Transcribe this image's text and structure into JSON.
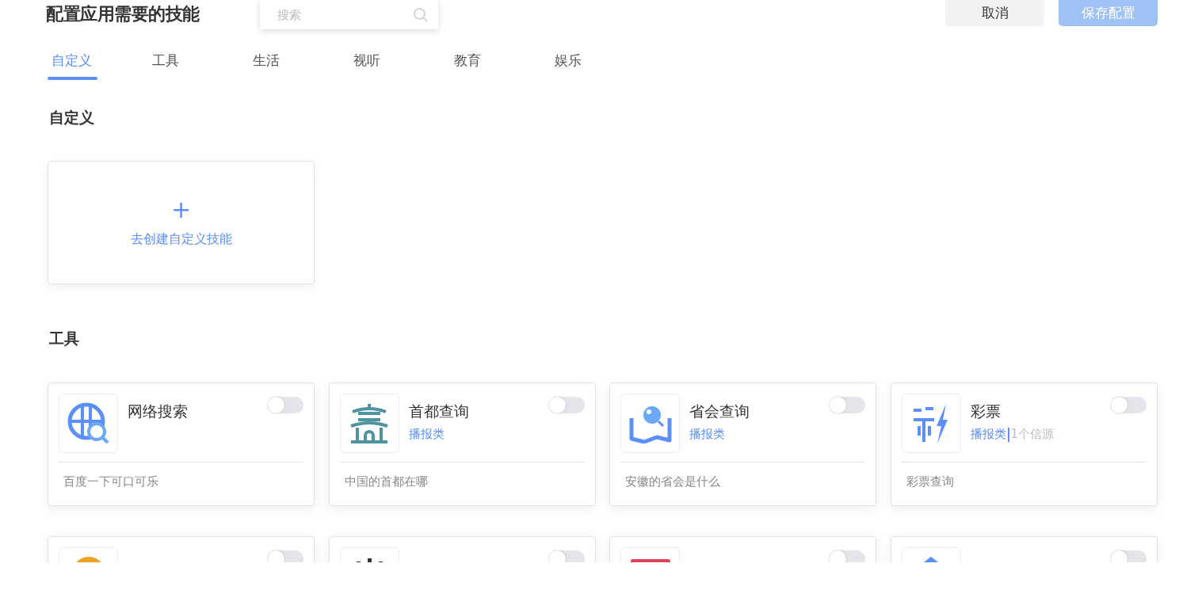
{
  "header": {
    "title": "配置应用需要的技能",
    "search": {
      "placeholder": "搜索"
    },
    "buttons": [
      {
        "label": "取消",
        "kind": "cancel",
        "disabled": false
      },
      {
        "label": "保存配置",
        "kind": "primary",
        "disabled": true
      }
    ]
  },
  "tabs": [
    {
      "label": "自定义",
      "selected": true
    },
    {
      "label": "工具",
      "selected": false
    },
    {
      "label": "生活",
      "selected": false
    },
    {
      "label": "视听",
      "selected": false
    },
    {
      "label": "教育",
      "selected": false
    },
    {
      "label": "娱乐",
      "selected": false
    }
  ],
  "custom_section": {
    "heading": "自定义",
    "create_card": {
      "icon": "+",
      "label": "去创建自定义技能"
    }
  },
  "tools_section": {
    "heading": "工具",
    "skills": [
      {
        "title": "网络搜索",
        "on": false,
        "example": "百度一下可口可乐"
      },
      {
        "title": "首都查询",
        "on": false,
        "category": "播报类",
        "example": "中国的首都在哪"
      },
      {
        "title": "省会查询",
        "on": false,
        "category": "播报类",
        "example": "安徽的省会是什么"
      },
      {
        "title": "彩票",
        "on": false,
        "category": "播报类",
        "sources": "1个信源",
        "example": "彩票查询"
      },
      {
        "on": false
      },
      {
        "on": false
      },
      {
        "on": false
      },
      {
        "on": false
      }
    ]
  }
}
